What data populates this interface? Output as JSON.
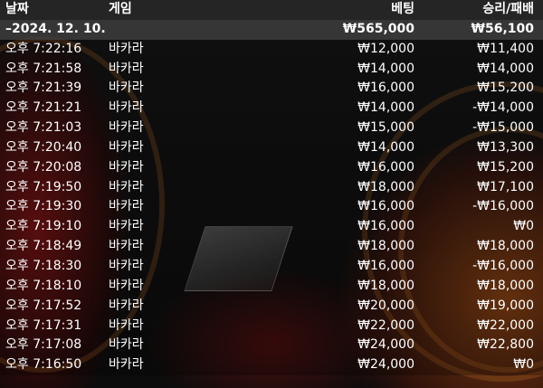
{
  "headers": {
    "date": "날짜",
    "game": "게임",
    "bet": "베팅",
    "result": "승리/패배"
  },
  "summary": {
    "date": "–2024. 12. 10.",
    "bet": "₩565,000",
    "result": "₩56,100"
  },
  "rows": [
    {
      "time": "오후 7:22:16",
      "game": "바카라",
      "bet": "₩12,000",
      "result": "₩11,400"
    },
    {
      "time": "오후 7:21:58",
      "game": "바카라",
      "bet": "₩14,000",
      "result": "₩14,000"
    },
    {
      "time": "오후 7:21:39",
      "game": "바카라",
      "bet": "₩16,000",
      "result": "₩15,200"
    },
    {
      "time": "오후 7:21:21",
      "game": "바카라",
      "bet": "₩14,000",
      "result": "-₩14,000"
    },
    {
      "time": "오후 7:21:03",
      "game": "바카라",
      "bet": "₩15,000",
      "result": "-₩15,000"
    },
    {
      "time": "오후 7:20:40",
      "game": "바카라",
      "bet": "₩14,000",
      "result": "₩13,300"
    },
    {
      "time": "오후 7:20:08",
      "game": "바카라",
      "bet": "₩16,000",
      "result": "₩15,200"
    },
    {
      "time": "오후 7:19:50",
      "game": "바카라",
      "bet": "₩18,000",
      "result": "₩17,100"
    },
    {
      "time": "오후 7:19:30",
      "game": "바카라",
      "bet": "₩16,000",
      "result": "-₩16,000"
    },
    {
      "time": "오후 7:19:10",
      "game": "바카라",
      "bet": "₩16,000",
      "result": "₩0"
    },
    {
      "time": "오후 7:18:49",
      "game": "바카라",
      "bet": "₩18,000",
      "result": "₩18,000"
    },
    {
      "time": "오후 7:18:30",
      "game": "바카라",
      "bet": "₩16,000",
      "result": "-₩16,000"
    },
    {
      "time": "오후 7:18:10",
      "game": "바카라",
      "bet": "₩18,000",
      "result": "₩18,000"
    },
    {
      "time": "오후 7:17:52",
      "game": "바카라",
      "bet": "₩20,000",
      "result": "₩19,000"
    },
    {
      "time": "오후 7:17:31",
      "game": "바카라",
      "bet": "₩22,000",
      "result": "₩22,000"
    },
    {
      "time": "오후 7:17:08",
      "game": "바카라",
      "bet": "₩24,000",
      "result": "₩22,800"
    },
    {
      "time": "오후 7:16:50",
      "game": "바카라",
      "bet": "₩24,000",
      "result": "₩0"
    }
  ]
}
